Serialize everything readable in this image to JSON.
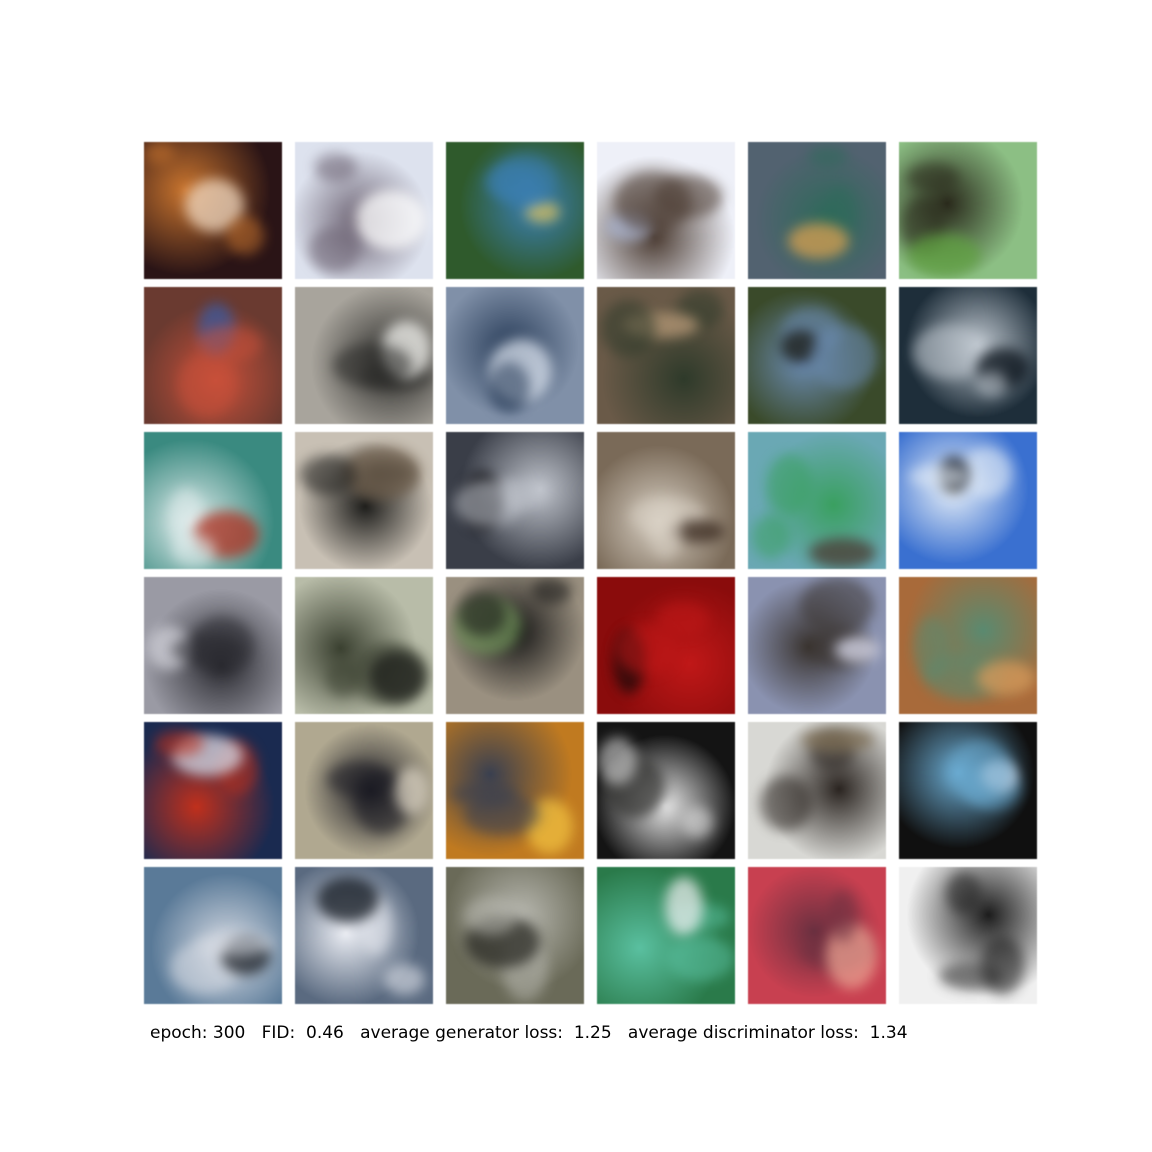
{
  "caption": {
    "epoch_label": "epoch:",
    "epoch_value": "300",
    "fid_label": "FID:",
    "fid_value": "0.46",
    "gen_label": "average generator loss:",
    "gen_value": "1.25",
    "disc_label": "average discriminator loss:",
    "disc_value": "1.34"
  },
  "samples": {
    "rows": 6,
    "cols": 6,
    "tiles": [
      {
        "bg": "#2a1416",
        "accent": "#c8742e",
        "spot": "#f0d8c0"
      },
      {
        "bg": "#dde2ee",
        "accent": "#6a6070",
        "spot": "#ffffff"
      },
      {
        "bg": "#2f5a2c",
        "accent": "#3b7fb4",
        "spot": "#d8c060"
      },
      {
        "bg": "#eef0f8",
        "accent": "#4a3a30",
        "spot": "#aab4d0"
      },
      {
        "bg": "#526270",
        "accent": "#2e6a5a",
        "spot": "#d8a050"
      },
      {
        "bg": "#8cbf84",
        "accent": "#2a2a1c",
        "spot": "#5fa040"
      },
      {
        "bg": "#6a3a30",
        "accent": "#c8503a",
        "spot": "#3a5aa0"
      },
      {
        "bg": "#a8a49c",
        "accent": "#2a2a28",
        "spot": "#f2f2ee"
      },
      {
        "bg": "#8090a8",
        "accent": "#2a3e5a",
        "spot": "#d8e0ec"
      },
      {
        "bg": "#6a5a48",
        "accent": "#2e3a2a",
        "spot": "#b89a78"
      },
      {
        "bg": "#3a4a2a",
        "accent": "#6a8ab0",
        "spot": "#1a1a14"
      },
      {
        "bg": "#1e2e3a",
        "accent": "#c0c8d0",
        "spot": "#0c141c"
      },
      {
        "bg": "#3a8a80",
        "accent": "#e0ecec",
        "spot": "#b03020"
      },
      {
        "bg": "#c8c0b4",
        "accent": "#1c1c1a",
        "spot": "#6a5a48"
      },
      {
        "bg": "#3a3e48",
        "accent": "#c0c4cc",
        "spot": "#0e0e12"
      },
      {
        "bg": "#7a6a58",
        "accent": "#d8d0c4",
        "spot": "#3a2a20"
      },
      {
        "bg": "#6aa8b4",
        "accent": "#3aa060",
        "spot": "#4a3a30"
      },
      {
        "bg": "#3a70d0",
        "accent": "#e8f0f8",
        "spot": "#141820"
      },
      {
        "bg": "#9a9aa4",
        "accent": "#2a2a30",
        "spot": "#d0d0d8"
      },
      {
        "bg": "#b8bca8",
        "accent": "#3a4030",
        "spot": "#1a1c18"
      },
      {
        "bg": "#9a9080",
        "accent": "#141414",
        "spot": "#70905a"
      },
      {
        "bg": "#8a0c0c",
        "accent": "#c01818",
        "spot": "#1c0a0a"
      },
      {
        "bg": "#8a92b0",
        "accent": "#3a3430",
        "spot": "#d8d8e8"
      },
      {
        "bg": "#a86a3a",
        "accent": "#5a8a70",
        "spot": "#d89a5a"
      },
      {
        "bg": "#1a2a50",
        "accent": "#c0301c",
        "spot": "#d8dce8"
      },
      {
        "bg": "#b0a890",
        "accent": "#1c1c24",
        "spot": "#d8d0c0"
      },
      {
        "bg": "#c07a20",
        "accent": "#3a4050",
        "spot": "#f0c040"
      },
      {
        "bg": "#141414",
        "accent": "#e8e8e8",
        "spot": "#3a3a38"
      },
      {
        "bg": "#d8d8d4",
        "accent": "#2a2420",
        "spot": "#7a6a50"
      },
      {
        "bg": "#101010",
        "accent": "#6aaad0",
        "spot": "#e0e0ea"
      },
      {
        "bg": "#5a7a98",
        "accent": "#d8dce4",
        "spot": "#1c2026"
      },
      {
        "bg": "#5a6a80",
        "accent": "#eceef4",
        "spot": "#141a22"
      },
      {
        "bg": "#6a6a58",
        "accent": "#b8b8b0",
        "spot": "#2a2a24"
      },
      {
        "bg": "#2a7a4a",
        "accent": "#5ac0a0",
        "spot": "#e8ecec"
      },
      {
        "bg": "#c84050",
        "accent": "#6a3040",
        "spot": "#e8a090"
      },
      {
        "bg": "#f0f0f0",
        "accent": "#1c1c1c",
        "spot": "#5a5a5a"
      }
    ]
  }
}
